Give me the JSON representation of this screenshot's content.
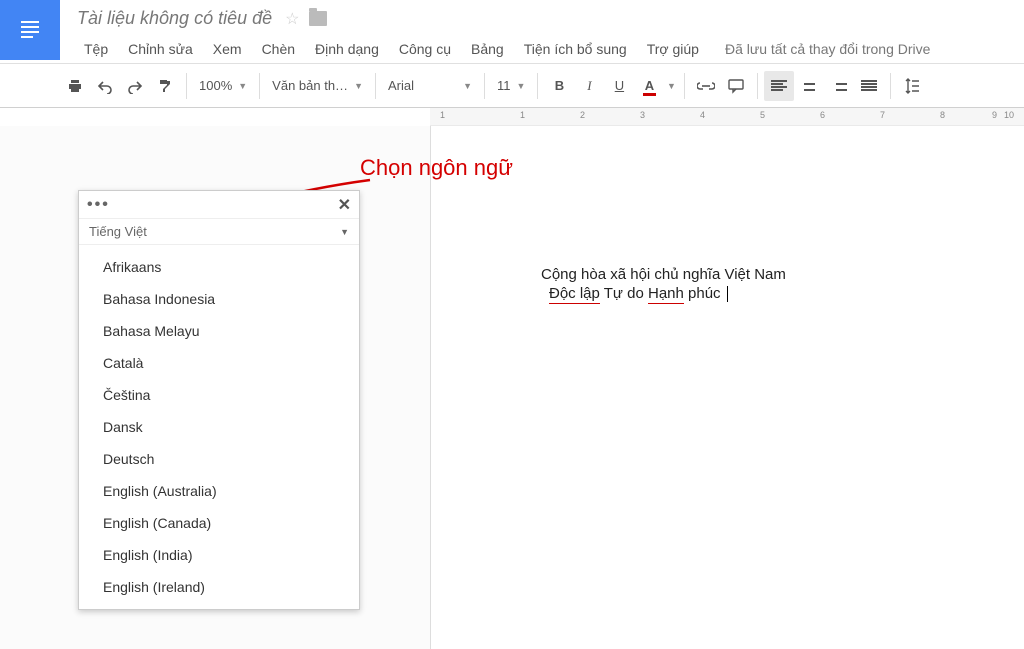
{
  "header": {
    "doc_title": "Tài liệu không có tiêu đề",
    "menus": [
      "Tệp",
      "Chỉnh sửa",
      "Xem",
      "Chèn",
      "Định dạng",
      "Công cụ",
      "Bảng",
      "Tiện ích bổ sung",
      "Trợ giúp"
    ],
    "save_status": "Đã lưu tất cả thay đổi trong Drive"
  },
  "toolbar": {
    "zoom": "100%",
    "style": "Văn bản th…",
    "font": "Arial",
    "font_size": "11",
    "bold": "B",
    "italic": "I",
    "underline": "U",
    "text_color": "A"
  },
  "ruler": {
    "labels": [
      "1",
      "",
      "1",
      "2",
      "3",
      "4",
      "5",
      "6",
      "7",
      "8",
      "9",
      "10"
    ]
  },
  "annotation": {
    "text": "Chọn ngôn ngữ"
  },
  "voice_panel": {
    "current_language": "Tiếng Việt",
    "languages": [
      "Afrikaans",
      "Bahasa Indonesia",
      "Bahasa Melayu",
      "Català",
      "Čeština",
      "Dansk",
      "Deutsch",
      "English (Australia)",
      "English (Canada)",
      "English (India)",
      "English (Ireland)"
    ]
  },
  "document": {
    "line1": "Cộng hòa xã hội chủ nghĩa Việt Nam",
    "line2a": "Độc lập",
    "line2b": " Tự do ",
    "line2c": "Hạnh",
    "line2d": " phúc "
  }
}
